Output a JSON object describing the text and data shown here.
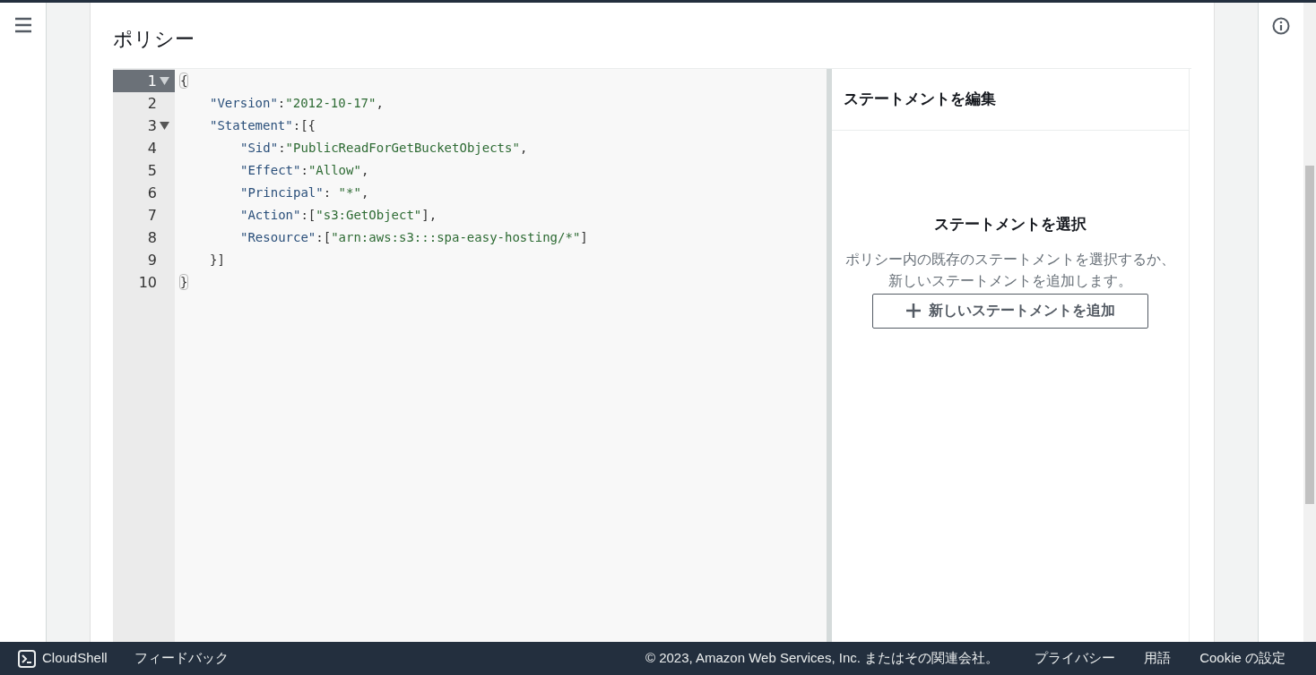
{
  "page": {
    "title": "ポリシー"
  },
  "editor": {
    "lines": [
      {
        "number": "1",
        "selected": true,
        "foldable": true,
        "tokens": [
          {
            "kind": "bracket-match",
            "text": "{"
          }
        ],
        "children": [
          {
            "number": "2",
            "selected": false,
            "foldable": false,
            "tokens": [
              {
                "kind": "key",
                "text": "\"Version\""
              },
              {
                "kind": "punct",
                "text": ":"
              },
              {
                "kind": "string",
                "text": "\"2012-10-17\""
              },
              {
                "kind": "punct",
                "text": ","
              }
            ]
          },
          {
            "number": "3",
            "selected": false,
            "foldable": true,
            "tokens": [
              {
                "kind": "key",
                "text": "\"Statement\""
              },
              {
                "kind": "punct",
                "text": ":[{"
              }
            ],
            "children": [
              {
                "number": "4",
                "selected": false,
                "foldable": false,
                "tokens": [
                  {
                    "kind": "key",
                    "text": "\"Sid\""
                  },
                  {
                    "kind": "punct",
                    "text": ":"
                  },
                  {
                    "kind": "string",
                    "text": "\"PublicReadForGetBucketObjects\""
                  },
                  {
                    "kind": "punct",
                    "text": ","
                  }
                ]
              },
              {
                "number": "5",
                "selected": false,
                "foldable": false,
                "tokens": [
                  {
                    "kind": "key",
                    "text": "\"Effect\""
                  },
                  {
                    "kind": "punct",
                    "text": ":"
                  },
                  {
                    "kind": "string",
                    "text": "\"Allow\""
                  },
                  {
                    "kind": "punct",
                    "text": ","
                  }
                ]
              },
              {
                "number": "6",
                "selected": false,
                "foldable": false,
                "tokens": [
                  {
                    "kind": "key",
                    "text": "\"Principal\""
                  },
                  {
                    "kind": "punct",
                    "text": ": "
                  },
                  {
                    "kind": "string",
                    "text": "\"*\""
                  },
                  {
                    "kind": "punct",
                    "text": ","
                  }
                ]
              },
              {
                "number": "7",
                "selected": false,
                "foldable": false,
                "tokens": [
                  {
                    "kind": "key",
                    "text": "\"Action\""
                  },
                  {
                    "kind": "punct",
                    "text": ":["
                  },
                  {
                    "kind": "string",
                    "text": "\"s3:GetObject\""
                  },
                  {
                    "kind": "punct",
                    "text": "],"
                  }
                ]
              },
              {
                "number": "8",
                "selected": false,
                "foldable": false,
                "tokens": [
                  {
                    "kind": "key",
                    "text": "\"Resource\""
                  },
                  {
                    "kind": "punct",
                    "text": ":["
                  },
                  {
                    "kind": "string",
                    "text": "\"arn:aws:s3:::spa-easy-hosting/*\""
                  },
                  {
                    "kind": "punct",
                    "text": "]"
                  }
                ]
              }
            ]
          },
          {
            "number": "9",
            "selected": false,
            "foldable": false,
            "tokens": [
              {
                "kind": "punct",
                "text": "}]"
              }
            ]
          }
        ]
      },
      {
        "number": "10",
        "selected": false,
        "foldable": false,
        "tokens": [
          {
            "kind": "bracket-match",
            "text": "}"
          }
        ]
      }
    ]
  },
  "statement_panel": {
    "title": "ステートメントを編集",
    "empty_title": "ステートメントを選択",
    "empty_text": "ポリシー内の既存のステートメントを選択するか、新しいステートメントを追加します。",
    "add_button": "新しいステートメントを追加"
  },
  "footer": {
    "left": [
      "CloudShell",
      "フィードバック"
    ],
    "copyright": "© 2023, Amazon Web Services, Inc. またはその関連会社。",
    "links": [
      "プライバシー",
      "用語",
      "Cookie の設定"
    ]
  }
}
